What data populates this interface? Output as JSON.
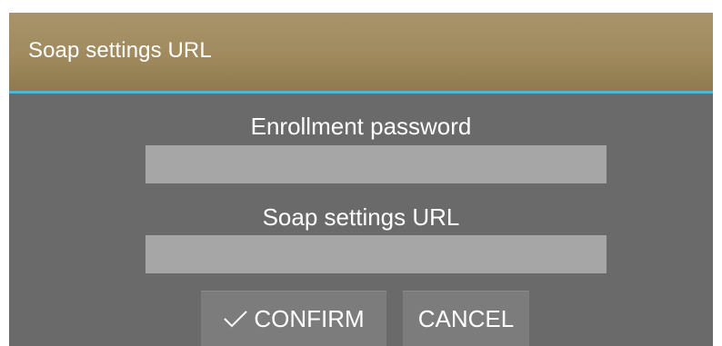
{
  "dialog": {
    "title": "Soap settings URL",
    "fields": [
      {
        "label": "Enrollment password",
        "value": "",
        "placeholder": ""
      },
      {
        "label": "Soap settings URL",
        "value": "",
        "placeholder": ""
      }
    ],
    "buttons": {
      "confirm_label": "CONFIRM",
      "confirm_icon": "check-icon",
      "cancel_label": "CANCEL"
    }
  },
  "colors": {
    "title_bar": "#a08a5e",
    "divider": "#4db6d8",
    "dialog_body": "#6a6a6a",
    "input_background": "#a6a6a6",
    "button_background": "#7c7c7c",
    "text": "#ffffff"
  }
}
